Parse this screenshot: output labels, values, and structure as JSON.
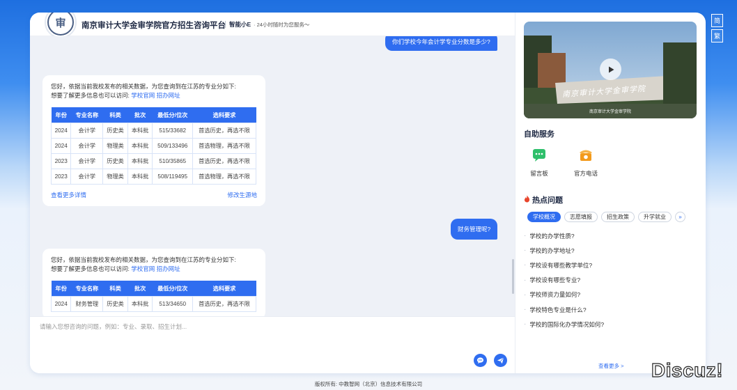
{
  "lang": {
    "simplified": "简",
    "traditional": "繁"
  },
  "header": {
    "logo_glyph": "审",
    "school_name": "南京审计大学金审学院官方招生咨询平台",
    "bot_name": "智能小E",
    "slogan": "· 24小时随时为您服务～"
  },
  "chat": {
    "messages": [
      {
        "role": "user",
        "text": "你们学校今年会计学专业分数是多少?"
      },
      {
        "role": "bot",
        "greeting": "您好，依据当前我校发布的相关数据，为您查询到在江苏的专业分如下:",
        "more_info_prefix": "想要了解更多信息也可以访问:",
        "links": [
          "学校官网",
          "招办网址"
        ],
        "table": {
          "headers": [
            "年份",
            "专业名称",
            "科类",
            "批次",
            "最低分/位次",
            "选科要求"
          ],
          "rows": [
            [
              "2024",
              "会计学",
              "历史类",
              "本科批",
              "515/33682",
              "首选历史，再选不限"
            ],
            [
              "2024",
              "会计学",
              "物理类",
              "本科批",
              "509/133496",
              "首选物理，再选不限"
            ],
            [
              "2023",
              "会计学",
              "历史类",
              "本科批",
              "510/35865",
              "首选历史，再选不限"
            ],
            [
              "2023",
              "会计学",
              "物理类",
              "本科批",
              "508/119495",
              "首选物理，再选不限"
            ]
          ]
        },
        "footer_left": "查看更多详情",
        "footer_right": "修改生源地"
      },
      {
        "role": "user",
        "text": "财务管理呢?"
      },
      {
        "role": "bot",
        "greeting": "您好，依据当前我校发布的相关数据，为您查询到在江苏的专业分如下:",
        "more_info_prefix": "想要了解更多信息也可以访问:",
        "links": [
          "学校官网",
          "招办网址"
        ],
        "table": {
          "headers": [
            "年份",
            "专业名称",
            "科类",
            "批次",
            "最低分/位次",
            "选科要求"
          ],
          "rows": [
            [
              "2024",
              "财务管理",
              "历史类",
              "本科批",
              "513/34650",
              "首选历史，再选不限"
            ]
          ]
        }
      }
    ]
  },
  "input": {
    "placeholder": "请输入您想咨询的问题，例如：专业、录取、招生计划..."
  },
  "right": {
    "video_caption": "南京审计大学金审学院",
    "video_sign": "南京审计大学金审学院",
    "self_service_title": "自助服务",
    "services": [
      {
        "label": "留言板",
        "icon": "message-board-icon",
        "color": "#2fbf6b"
      },
      {
        "label": "官方电话",
        "icon": "phone-icon",
        "color": "#f39a1b"
      }
    ],
    "hot_title": "热点问题",
    "tabs": [
      "学校概况",
      "志愿填报",
      "招生政策",
      "升学就业"
    ],
    "active_tab": 0,
    "faq": [
      "学校的办学性质?",
      "学校的办学地址?",
      "学校设有哪些教学单位?",
      "学校设有哪些专业?",
      "学校师资力量如何?",
      "学校特色专业是什么?",
      "学校的国际化办学情况如何?"
    ],
    "see_more": "查看更多 >"
  },
  "footer": {
    "copyright": "版权所有: 中教智网（北京）信息技术有限公司"
  },
  "watermark": "Discuz!",
  "colors": {
    "accent": "#2f6df0",
    "bg_blue": "#1e6fe0"
  }
}
